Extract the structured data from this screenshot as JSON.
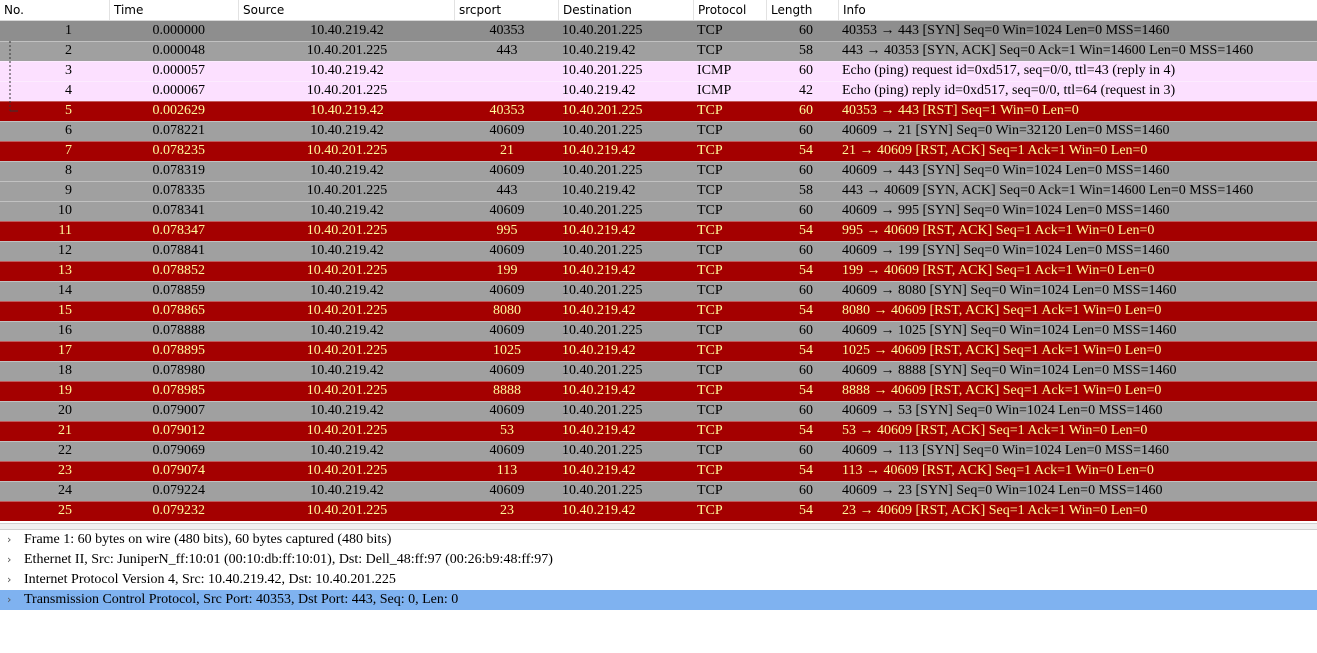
{
  "packet_list": {
    "columns": [
      "No.",
      "Time",
      "Source",
      "srcport",
      "Destination",
      "Protocol",
      "Length",
      "Info"
    ],
    "rows": [
      {
        "no": "1",
        "time": "0.000000",
        "src": "10.40.219.42",
        "sport": "40353",
        "dst": "10.40.201.225",
        "proto": "TCP",
        "len": "60",
        "info": "40353 → 443 [SYN] Seq=0 Win=1024 Len=0 MSS=1460",
        "style": "gray",
        "selected": true
      },
      {
        "no": "2",
        "time": "0.000048",
        "src": "10.40.201.225",
        "sport": "443",
        "dst": "10.40.219.42",
        "proto": "TCP",
        "len": "58",
        "info": "443 → 40353 [SYN, ACK] Seq=0 Ack=1 Win=14600 Len=0 MSS=1460",
        "style": "gray"
      },
      {
        "no": "3",
        "time": "0.000057",
        "src": "10.40.219.42",
        "sport": "",
        "dst": "10.40.201.225",
        "proto": "ICMP",
        "len": "60",
        "info": "Echo (ping) request  id=0xd517, seq=0/0, ttl=43 (reply in 4)",
        "style": "pink"
      },
      {
        "no": "4",
        "time": "0.000067",
        "src": "10.40.201.225",
        "sport": "",
        "dst": "10.40.219.42",
        "proto": "ICMP",
        "len": "42",
        "info": "Echo (ping) reply    id=0xd517, seq=0/0, ttl=64 (request in 3)",
        "style": "pink"
      },
      {
        "no": "5",
        "time": "0.002629",
        "src": "10.40.219.42",
        "sport": "40353",
        "dst": "10.40.201.225",
        "proto": "TCP",
        "len": "60",
        "info": "40353 → 443 [RST] Seq=1 Win=0 Len=0",
        "style": "red"
      },
      {
        "no": "6",
        "time": "0.078221",
        "src": "10.40.219.42",
        "sport": "40609",
        "dst": "10.40.201.225",
        "proto": "TCP",
        "len": "60",
        "info": "40609 → 21 [SYN] Seq=0 Win=32120 Len=0 MSS=1460",
        "style": "gray"
      },
      {
        "no": "7",
        "time": "0.078235",
        "src": "10.40.201.225",
        "sport": "21",
        "dst": "10.40.219.42",
        "proto": "TCP",
        "len": "54",
        "info": "21 → 40609 [RST, ACK] Seq=1 Ack=1 Win=0 Len=0",
        "style": "red"
      },
      {
        "no": "8",
        "time": "0.078319",
        "src": "10.40.219.42",
        "sport": "40609",
        "dst": "10.40.201.225",
        "proto": "TCP",
        "len": "60",
        "info": "40609 → 443 [SYN] Seq=0 Win=1024 Len=0 MSS=1460",
        "style": "gray"
      },
      {
        "no": "9",
        "time": "0.078335",
        "src": "10.40.201.225",
        "sport": "443",
        "dst": "10.40.219.42",
        "proto": "TCP",
        "len": "58",
        "info": "443 → 40609 [SYN, ACK] Seq=0 Ack=1 Win=14600 Len=0 MSS=1460",
        "style": "gray"
      },
      {
        "no": "10",
        "time": "0.078341",
        "src": "10.40.219.42",
        "sport": "40609",
        "dst": "10.40.201.225",
        "proto": "TCP",
        "len": "60",
        "info": "40609 → 995 [SYN] Seq=0 Win=1024 Len=0 MSS=1460",
        "style": "gray"
      },
      {
        "no": "11",
        "time": "0.078347",
        "src": "10.40.201.225",
        "sport": "995",
        "dst": "10.40.219.42",
        "proto": "TCP",
        "len": "54",
        "info": "995 → 40609 [RST, ACK] Seq=1 Ack=1 Win=0 Len=0",
        "style": "red"
      },
      {
        "no": "12",
        "time": "0.078841",
        "src": "10.40.219.42",
        "sport": "40609",
        "dst": "10.40.201.225",
        "proto": "TCP",
        "len": "60",
        "info": "40609 → 199 [SYN] Seq=0 Win=1024 Len=0 MSS=1460",
        "style": "gray"
      },
      {
        "no": "13",
        "time": "0.078852",
        "src": "10.40.201.225",
        "sport": "199",
        "dst": "10.40.219.42",
        "proto": "TCP",
        "len": "54",
        "info": "199 → 40609 [RST, ACK] Seq=1 Ack=1 Win=0 Len=0",
        "style": "red"
      },
      {
        "no": "14",
        "time": "0.078859",
        "src": "10.40.219.42",
        "sport": "40609",
        "dst": "10.40.201.225",
        "proto": "TCP",
        "len": "60",
        "info": "40609 → 8080 [SYN] Seq=0 Win=1024 Len=0 MSS=1460",
        "style": "gray"
      },
      {
        "no": "15",
        "time": "0.078865",
        "src": "10.40.201.225",
        "sport": "8080",
        "dst": "10.40.219.42",
        "proto": "TCP",
        "len": "54",
        "info": "8080 → 40609 [RST, ACK] Seq=1 Ack=1 Win=0 Len=0",
        "style": "red"
      },
      {
        "no": "16",
        "time": "0.078888",
        "src": "10.40.219.42",
        "sport": "40609",
        "dst": "10.40.201.225",
        "proto": "TCP",
        "len": "60",
        "info": "40609 → 1025 [SYN] Seq=0 Win=1024 Len=0 MSS=1460",
        "style": "gray"
      },
      {
        "no": "17",
        "time": "0.078895",
        "src": "10.40.201.225",
        "sport": "1025",
        "dst": "10.40.219.42",
        "proto": "TCP",
        "len": "54",
        "info": "1025 → 40609 [RST, ACK] Seq=1 Ack=1 Win=0 Len=0",
        "style": "red"
      },
      {
        "no": "18",
        "time": "0.078980",
        "src": "10.40.219.42",
        "sport": "40609",
        "dst": "10.40.201.225",
        "proto": "TCP",
        "len": "60",
        "info": "40609 → 8888 [SYN] Seq=0 Win=1024 Len=0 MSS=1460",
        "style": "gray"
      },
      {
        "no": "19",
        "time": "0.078985",
        "src": "10.40.201.225",
        "sport": "8888",
        "dst": "10.40.219.42",
        "proto": "TCP",
        "len": "54",
        "info": "8888 → 40609 [RST, ACK] Seq=1 Ack=1 Win=0 Len=0",
        "style": "red"
      },
      {
        "no": "20",
        "time": "0.079007",
        "src": "10.40.219.42",
        "sport": "40609",
        "dst": "10.40.201.225",
        "proto": "TCP",
        "len": "60",
        "info": "40609 → 53 [SYN] Seq=0 Win=1024 Len=0 MSS=1460",
        "style": "gray"
      },
      {
        "no": "21",
        "time": "0.079012",
        "src": "10.40.201.225",
        "sport": "53",
        "dst": "10.40.219.42",
        "proto": "TCP",
        "len": "54",
        "info": "53 → 40609 [RST, ACK] Seq=1 Ack=1 Win=0 Len=0",
        "style": "red"
      },
      {
        "no": "22",
        "time": "0.079069",
        "src": "10.40.219.42",
        "sport": "40609",
        "dst": "10.40.201.225",
        "proto": "TCP",
        "len": "60",
        "info": "40609 → 113 [SYN] Seq=0 Win=1024 Len=0 MSS=1460",
        "style": "gray"
      },
      {
        "no": "23",
        "time": "0.079074",
        "src": "10.40.201.225",
        "sport": "113",
        "dst": "10.40.219.42",
        "proto": "TCP",
        "len": "54",
        "info": "113 → 40609 [RST, ACK] Seq=1 Ack=1 Win=0 Len=0",
        "style": "red"
      },
      {
        "no": "24",
        "time": "0.079224",
        "src": "10.40.219.42",
        "sport": "40609",
        "dst": "10.40.201.225",
        "proto": "TCP",
        "len": "60",
        "info": "40609 → 23 [SYN] Seq=0 Win=1024 Len=0 MSS=1460",
        "style": "gray"
      },
      {
        "no": "25",
        "time": "0.079232",
        "src": "10.40.201.225",
        "sport": "23",
        "dst": "10.40.219.42",
        "proto": "TCP",
        "len": "54",
        "info": "23 → 40609 [RST, ACK] Seq=1 Ack=1 Win=0 Len=0",
        "style": "red"
      }
    ]
  },
  "packet_details": [
    {
      "label": "Frame 1: 60 bytes on wire (480 bits), 60 bytes captured (480 bits)",
      "selected": false
    },
    {
      "label": "Ethernet II, Src: JuniperN_ff:10:01 (00:10:db:ff:10:01), Dst: Dell_48:ff:97 (00:26:b9:48:ff:97)",
      "selected": false
    },
    {
      "label": "Internet Protocol Version 4, Src: 10.40.219.42, Dst: 10.40.201.225",
      "selected": false
    },
    {
      "label": "Transmission Control Protocol, Src Port: 40353, Dst Port: 443, Seq: 0, Len: 0",
      "selected": true
    }
  ],
  "icons": {
    "expand": "chevron-right-icon",
    "conversation": "conversation-bracket-icon"
  },
  "colors": {
    "tcp_gray": "#a0a0a0",
    "rst_red": "#a40000",
    "rst_text": "#fffc9c",
    "icmp_pink": "#fce0ff",
    "selection_blue": "#7fb2f0"
  }
}
